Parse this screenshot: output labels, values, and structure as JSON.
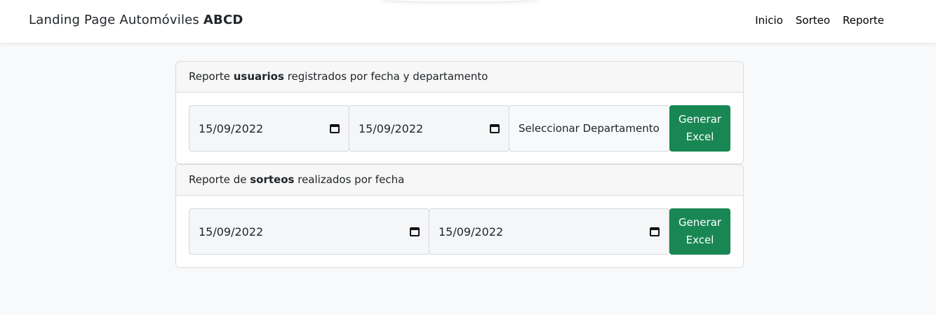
{
  "navbar": {
    "brand_prefix": "Landing Page Automóviles ",
    "brand_bold": "ABCD",
    "links": [
      "Inicio",
      "Sorteo",
      "Reporte"
    ]
  },
  "report_users": {
    "header_pre": "Reporte ",
    "header_bold": "usuarios",
    "header_post": " registrados por fecha y departamento",
    "date_from": "15/09/2022",
    "date_to": "15/09/2022",
    "select_value": "Seleccionar Departamento..",
    "button_line1": "Generar",
    "button_line2": "Excel"
  },
  "report_raffles": {
    "header_pre": "Reporte de ",
    "header_bold": "sorteos",
    "header_post": " realizados por fecha",
    "date_from": "15/09/2022",
    "date_to": "15/09/2022",
    "button_line1": "Generar",
    "button_line2": "Excel"
  },
  "icons": {
    "date_picker": "calendar-icon"
  },
  "colors": {
    "button": "#198754",
    "background": "#f8f9fa"
  }
}
